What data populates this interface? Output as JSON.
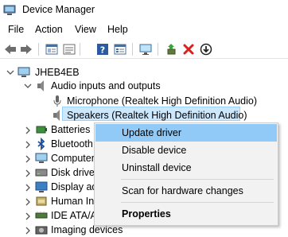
{
  "window": {
    "title": "Device Manager"
  },
  "menubar": {
    "items": [
      "File",
      "Action",
      "View",
      "Help"
    ]
  },
  "toolbar": {
    "buttons": [
      "back-icon",
      "forward-icon",
      "properties-icon",
      "show-hidden-icon",
      "help-icon",
      "properties-list-icon",
      "monitor-scan-icon",
      "update-driver-icon",
      "uninstall-icon",
      "disable-icon"
    ]
  },
  "tree": {
    "root": "JHEB4EB",
    "audio": "Audio inputs and outputs",
    "microphone": "Microphone (Realtek High Definition Audio)",
    "speakers": "Speakers (Realtek High Definition Audio)",
    "batteries": "Batteries",
    "bluetooth": "Bluetooth",
    "computer": "Computer",
    "disk": "Disk drives",
    "display": "Display ad",
    "hid": "Human Inte",
    "ide": "IDE ATA/A",
    "imaging": "Imaging devices"
  },
  "context_menu": {
    "update": "Update driver",
    "disable": "Disable device",
    "uninstall": "Uninstall device",
    "scan": "Scan for hardware changes",
    "properties": "Properties"
  },
  "colors": {
    "selection": "#cce8ff",
    "menu_highlight": "#91c9f7",
    "uninstall_red": "#d9201f"
  }
}
